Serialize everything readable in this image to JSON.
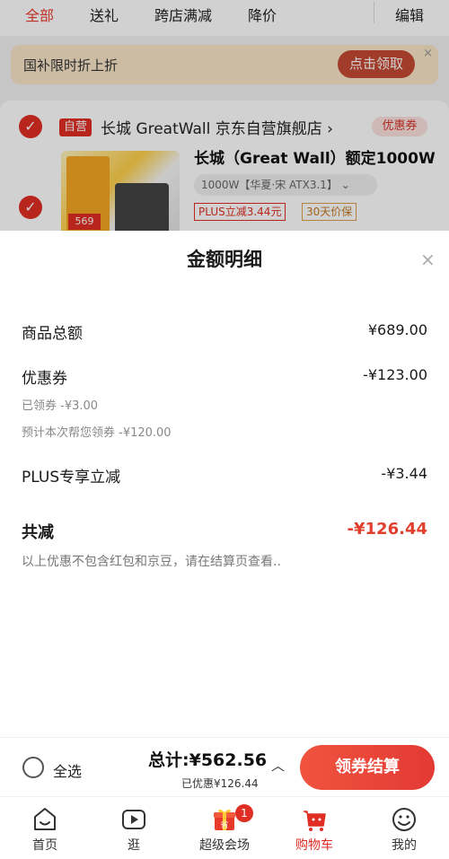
{
  "tabs": [
    {
      "label": "全部",
      "active": true
    },
    {
      "label": "送礼",
      "active": false
    },
    {
      "label": "跨店满减",
      "active": false
    },
    {
      "label": "降价",
      "active": false
    }
  ],
  "edit_label": "编辑",
  "promo": {
    "text": "国补限时折上折",
    "button": "点击领取",
    "close": "×"
  },
  "store": {
    "badge": "自营",
    "name": "长城 GreatWall 京东自营旗舰店 ›",
    "coupon": "优惠券",
    "checked": true
  },
  "product": {
    "title": "长城（Great Wall）额定1000W",
    "spec": "1000W【华夏·宋 ATX3.1】 ⌄",
    "plus_tag": "PLUS立减3.44元",
    "price_protect_tag": "30天价保",
    "image_text": "569",
    "checked": true
  },
  "sheet": {
    "title": "金额明细",
    "close": "×",
    "rows": {
      "goods_total": {
        "label": "商品总额",
        "value": "¥689.00"
      },
      "coupon": {
        "label": "优惠券",
        "value": "-¥123.00"
      },
      "coupon_claimed": "已领券 -¥3.00",
      "coupon_estimated": "预计本次帮您领券 -¥120.00",
      "plus": {
        "label": "PLUS专享立减",
        "value": "-¥3.44"
      },
      "total_reduction": {
        "label": "共减",
        "value": "-¥126.44"
      }
    },
    "note": "以上优惠不包含红包和京豆，请在结算页查看.."
  },
  "checkout": {
    "select_all": "全选",
    "total": "总计:¥562.56",
    "discount": "已优惠¥126.44",
    "chevron": "︿",
    "button": "领券结算"
  },
  "nav": [
    {
      "label": "首页",
      "icon": "home-face-icon",
      "active": false
    },
    {
      "label": "逛",
      "icon": "play-video-icon",
      "active": false
    },
    {
      "label": "超级会场",
      "icon": "gift-box-icon",
      "active": false,
      "badge": "1"
    },
    {
      "label": "购物车",
      "icon": "shopping-cart-icon",
      "active": true
    },
    {
      "label": "我的",
      "icon": "smile-face-icon",
      "active": false
    }
  ],
  "colors": {
    "accent": "#e02e24",
    "discount_red": "#e03f2d"
  }
}
